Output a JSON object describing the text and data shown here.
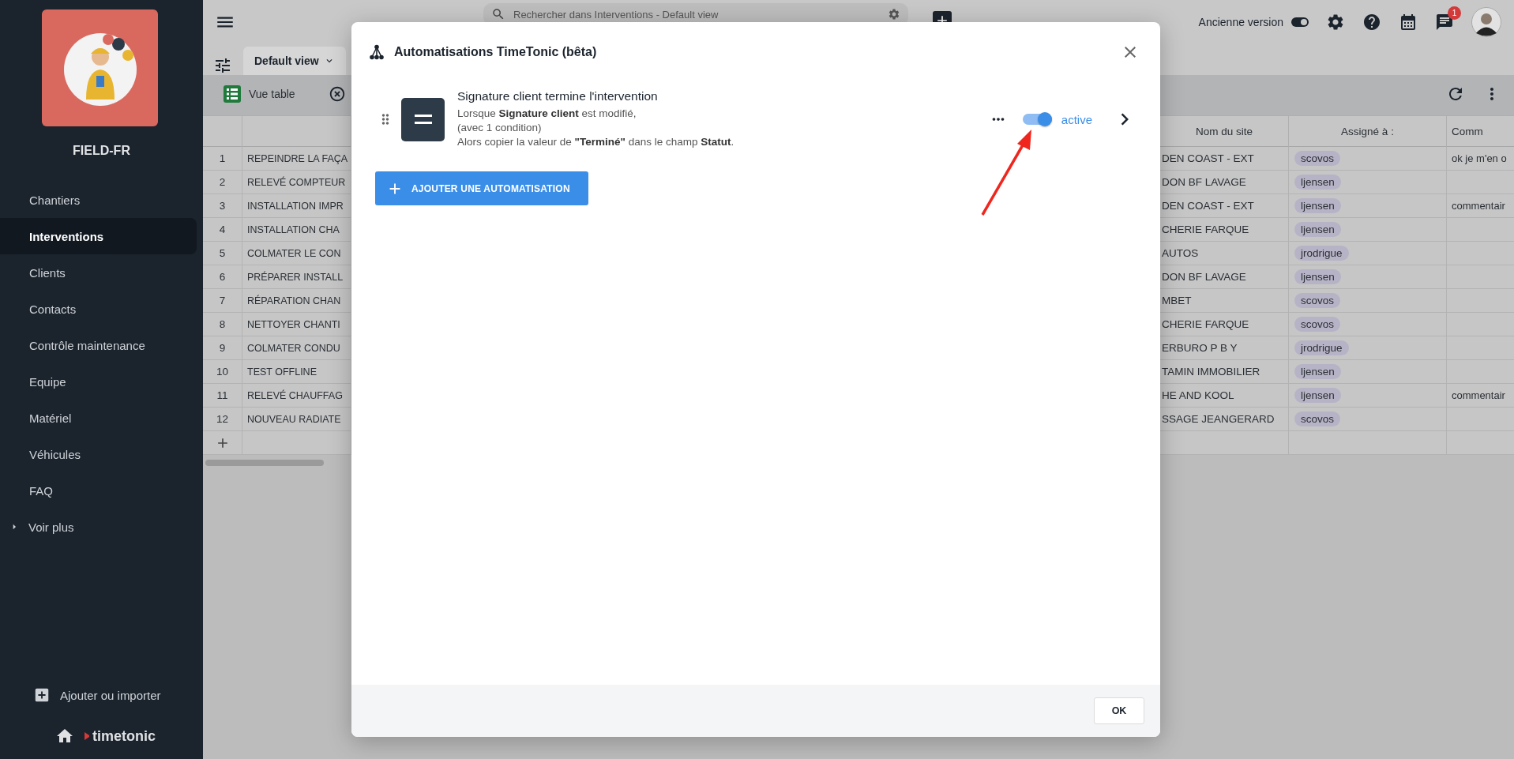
{
  "sidebar": {
    "workspace": "FIELD-FR",
    "items": [
      {
        "label": "Chantiers",
        "selected": false
      },
      {
        "label": "Interventions",
        "selected": true
      },
      {
        "label": "Clients",
        "selected": false
      },
      {
        "label": "Contacts",
        "selected": false
      },
      {
        "label": "Contrôle maintenance",
        "selected": false
      },
      {
        "label": "Equipe",
        "selected": false
      },
      {
        "label": "Matériel",
        "selected": false
      },
      {
        "label": "Véhicules",
        "selected": false
      },
      {
        "label": "FAQ",
        "selected": false
      }
    ],
    "more": "Voir plus",
    "add": "Ajouter ou importer",
    "brand": "timetonic"
  },
  "topbar": {
    "search": {
      "placeholder": "Rechercher dans Interventions - Default view"
    },
    "old_version": {
      "label": "Ancienne version",
      "on": true
    },
    "notifications": "1"
  },
  "view_tab": {
    "label": "Default view",
    "selected": true
  },
  "toolbar": {
    "view": "Vue table"
  },
  "table": {
    "columns": [
      "Nom du site",
      "Assigné à :",
      "Comm"
    ],
    "rows": [
      {
        "n": "1",
        "title": "REPEINDRE LA FAÇA",
        "site": "DEN COAST - EXT",
        "assignee": "scovos",
        "comment": "ok je m'en o"
      },
      {
        "n": "2",
        "title": "RELEVÉ COMPTEUR",
        "site": "DON BF LAVAGE",
        "assignee": "ljensen"
      },
      {
        "n": "3",
        "title": "INSTALLATION IMPR",
        "site": "DEN COAST - EXT",
        "assignee": "ljensen",
        "comment": "commentair"
      },
      {
        "n": "4",
        "title": "INSTALLATION CHA",
        "site": "CHERIE FARQUE",
        "assignee": "ljensen"
      },
      {
        "n": "5",
        "title": "COLMATER LE CON",
        "site": "AUTOS",
        "assignee": "jrodrigue"
      },
      {
        "n": "6",
        "title": "PRÉPARER INSTALL",
        "site": "DON BF LAVAGE",
        "assignee": "ljensen"
      },
      {
        "n": "7",
        "title": "RÉPARATION CHAN",
        "site": "MBET",
        "assignee": "scovos"
      },
      {
        "n": "8",
        "title": "NETTOYER CHANTI",
        "site": "CHERIE FARQUE",
        "assignee": "scovos"
      },
      {
        "n": "9",
        "title": "COLMATER CONDU",
        "site": "ERBURO P B Y",
        "assignee": "jrodrigue"
      },
      {
        "n": "10",
        "title": "TEST OFFLINE",
        "site": "TAMIN IMMOBILIER",
        "assignee": "ljensen"
      },
      {
        "n": "11",
        "title": "RELEVÉ CHAUFFAG",
        "site": "HE AND KOOL",
        "assignee": "ljensen",
        "comment": "commentair"
      },
      {
        "n": "12",
        "title": "NOUVEAU RADIATE",
        "site": "SSAGE JEANGERARD",
        "assignee": "scovos"
      }
    ]
  },
  "modal": {
    "title": "Automatisations TimeTonic (bêta)",
    "automations": [
      {
        "title": "Signature client termine l'intervention",
        "lines": [
          "Lorsque **Signature client** est modifié,",
          "(avec 1 condition)",
          "Alors copier la valeur de **\"Terminé\"** dans le champ **Statut**."
        ],
        "active": true,
        "status": "active"
      }
    ],
    "add_button": "AJOUTER UNE AUTOMATISATION",
    "ok_button": "OK"
  }
}
